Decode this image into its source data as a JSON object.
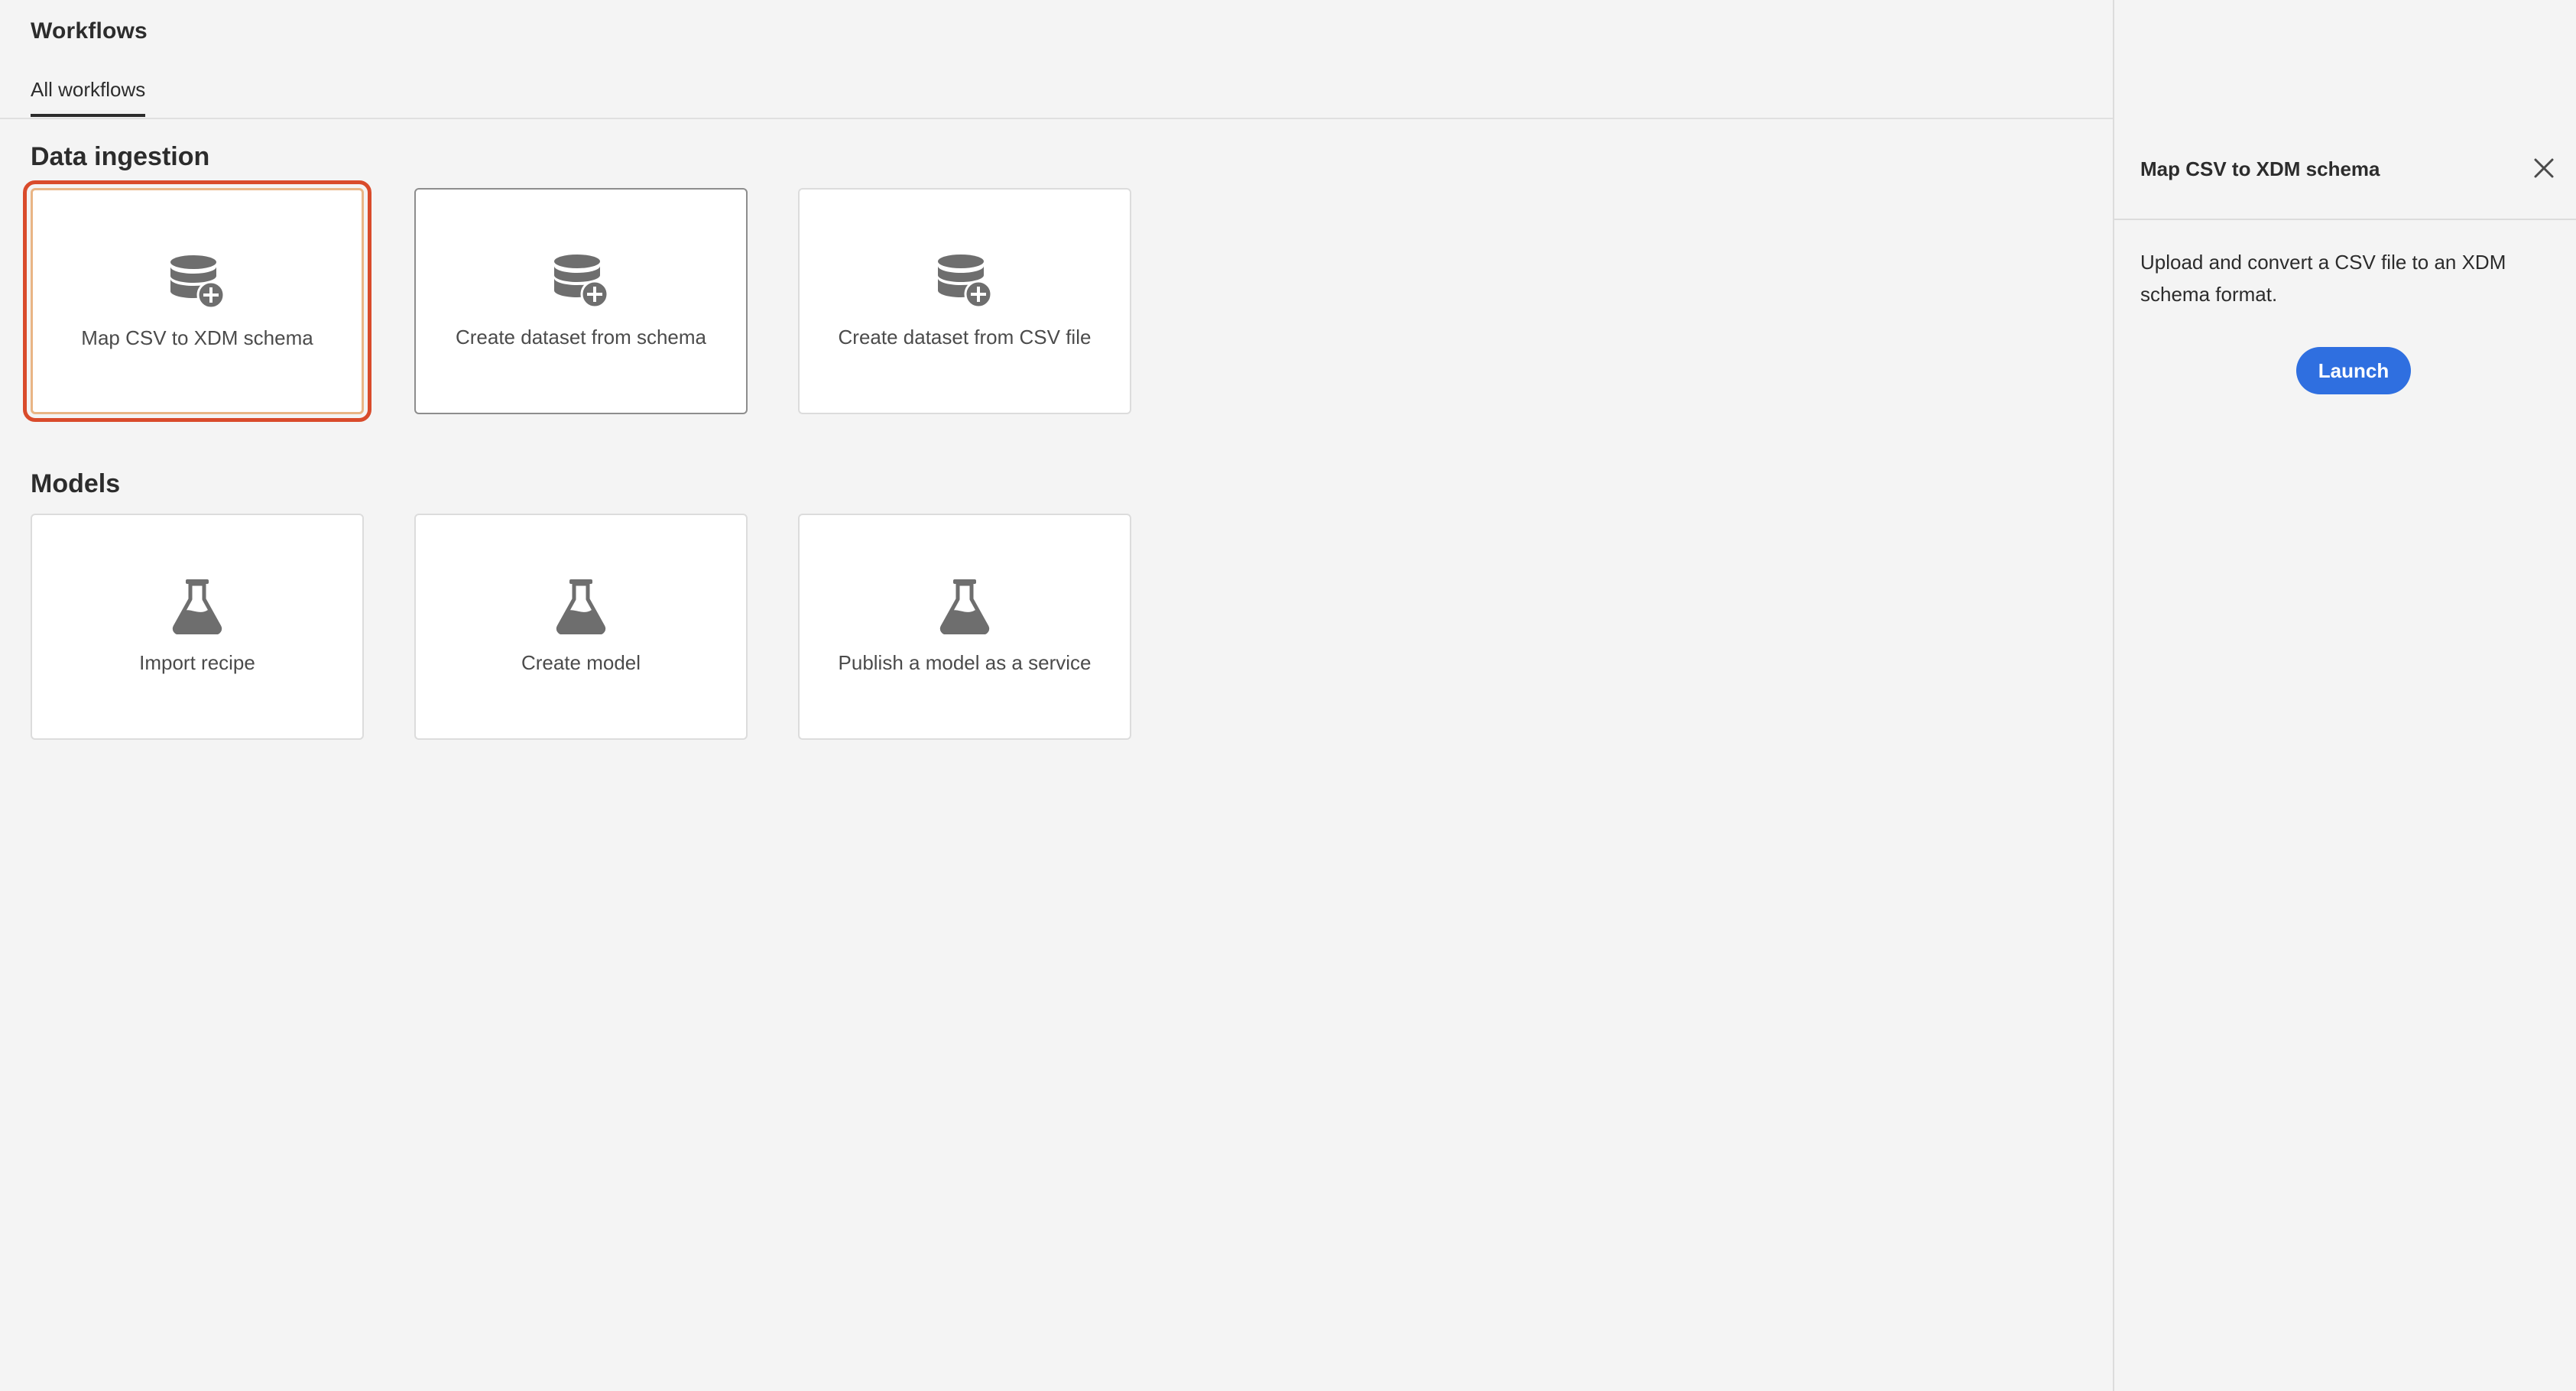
{
  "app": {
    "title": "Workflows"
  },
  "tabs": [
    {
      "label": "All workflows",
      "active": true
    }
  ],
  "sections": [
    {
      "title": "Data ingestion",
      "cards": [
        {
          "label": "Map CSV to XDM schema",
          "icon": "database-plus-icon",
          "state": "selected"
        },
        {
          "label": "Create dataset from schema",
          "icon": "database-plus-icon",
          "state": "hover"
        },
        {
          "label": "Create dataset from CSV file",
          "icon": "database-plus-icon",
          "state": "normal"
        }
      ]
    },
    {
      "title": "Models",
      "cards": [
        {
          "label": "Import recipe",
          "icon": "flask-icon",
          "state": "normal"
        },
        {
          "label": "Create model",
          "icon": "flask-icon",
          "state": "normal"
        },
        {
          "label": "Publish a model as a service",
          "icon": "flask-icon",
          "state": "normal"
        }
      ]
    }
  ],
  "panel": {
    "title": "Map CSV to XDM schema",
    "description": "Upload and convert a CSV file to an XDM schema format.",
    "launch_label": "Launch",
    "close_icon": "close-icon"
  },
  "colors": {
    "background": "#f4f4f4",
    "card": "#ffffff",
    "accent_blue": "#2f6fe0",
    "selection_red": "#d94b2b",
    "icon_gray": "#6e6e6e"
  }
}
